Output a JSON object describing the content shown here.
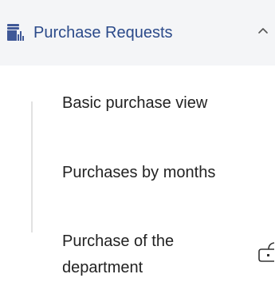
{
  "menu": {
    "section_title": "Purchase Requests",
    "section_icon": "report-chart-icon",
    "expanded_icon": "chevron-up-icon",
    "items": [
      {
        "label": "Basic purchase view"
      },
      {
        "label": "Purchases by months"
      },
      {
        "label": "Purchase of the department",
        "trailing_icon": "open-in-new-icon"
      }
    ]
  },
  "colors": {
    "header_background": "#f4f5f7",
    "header_text": "#2b4a8a",
    "icon_primary": "#3f5897",
    "item_text": "#222222",
    "tree_line": "#e2e2e2"
  }
}
